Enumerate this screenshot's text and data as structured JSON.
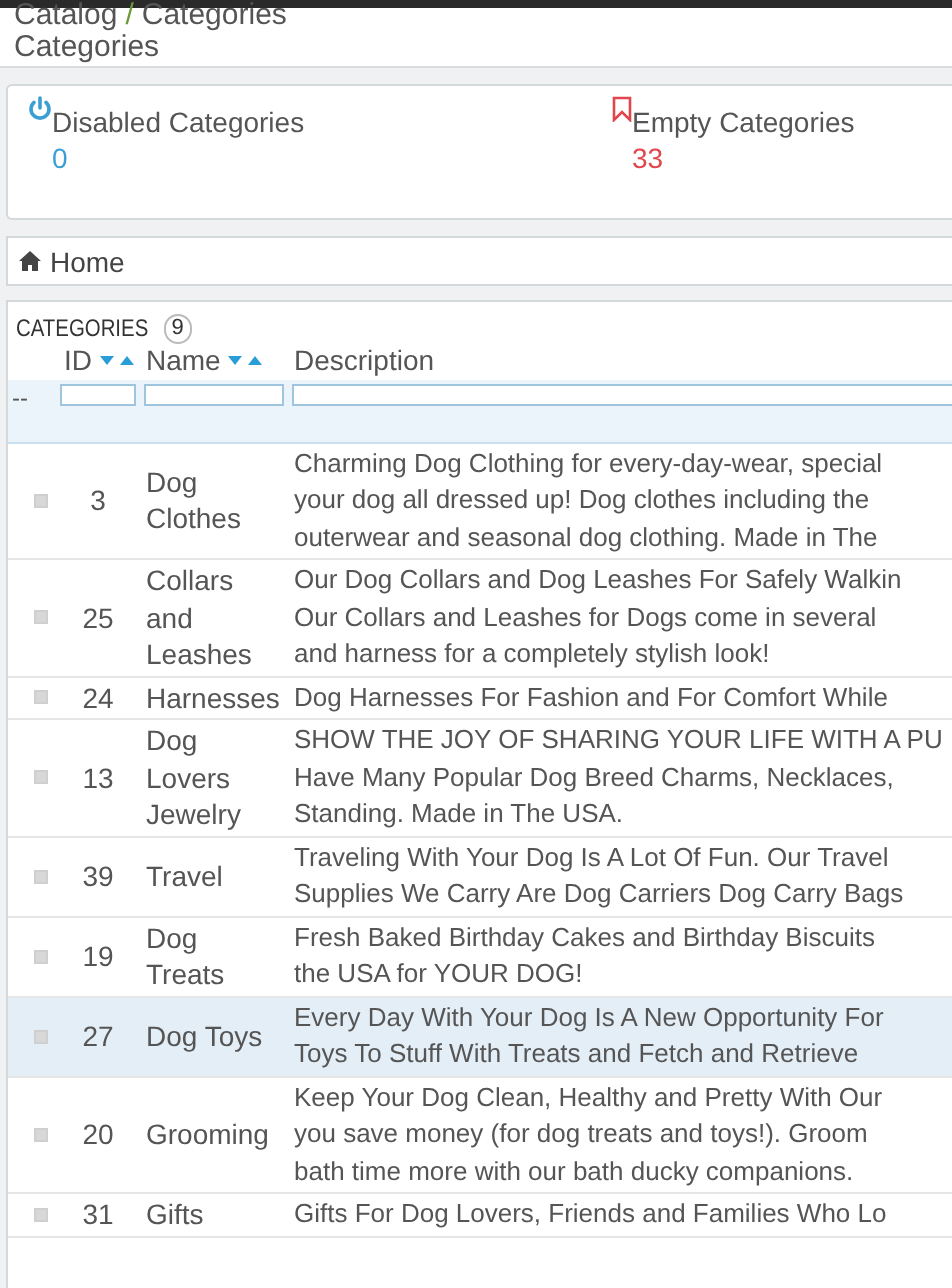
{
  "breadcrumb": {
    "items": [
      "Catalog",
      "Categories"
    ],
    "separator": "/"
  },
  "page_title": "Categories",
  "kpis": [
    {
      "kind": "disabled",
      "label": "Disabled Categories",
      "value": "0",
      "color": "#3c9fd4"
    },
    {
      "kind": "empty",
      "label": "Empty Categories",
      "value": "33",
      "color": "#e0464c"
    }
  ],
  "home_bar": {
    "label": "Home"
  },
  "table": {
    "title": "CATEGORIES",
    "count": "9",
    "columns": [
      {
        "label": "ID",
        "sortable": true
      },
      {
        "label": "Name",
        "sortable": true
      },
      {
        "label": "Description",
        "sortable": false
      }
    ],
    "filter_reset": "--",
    "rows": [
      {
        "id": "3",
        "name": "Dog Clothes",
        "checked": false,
        "highlighted": false,
        "description": [
          "Charming Dog Clothing for every-day-wear, special",
          "your dog all dressed up! Dog clothes including the",
          "outerwear and seasonal dog clothing. Made in The"
        ]
      },
      {
        "id": "25",
        "name": "Collars and Leashes",
        "checked": false,
        "highlighted": false,
        "description": [
          "Our Dog Collars and Dog Leashes For Safely Walkin",
          "Our Collars and Leashes for Dogs come in several",
          "and harness for a completely stylish look!"
        ]
      },
      {
        "id": "24",
        "name": "Harnesses",
        "checked": false,
        "highlighted": false,
        "description": [
          "Dog Harnesses For Fashion and For Comfort While"
        ]
      },
      {
        "id": "13",
        "name": "Dog Lovers Jewelry",
        "checked": false,
        "highlighted": false,
        "description": [
          "SHOW THE JOY OF SHARING YOUR LIFE WITH A PU",
          "Have Many Popular Dog Breed Charms, Necklaces,",
          "Standing. Made in The USA."
        ]
      },
      {
        "id": "39",
        "name": "Travel",
        "checked": false,
        "highlighted": false,
        "description": [
          "Traveling With Your Dog Is A Lot Of Fun. Our Travel",
          "Supplies We Carry Are Dog Carriers Dog Carry Bags"
        ]
      },
      {
        "id": "19",
        "name": "Dog Treats",
        "checked": false,
        "highlighted": false,
        "description": [
          "Fresh Baked Birthday Cakes and Birthday Biscuits",
          "the USA for YOUR DOG!"
        ]
      },
      {
        "id": "27",
        "name": "Dog Toys",
        "checked": false,
        "highlighted": true,
        "description": [
          "Every Day With Your Dog Is A New Opportunity For",
          "Toys To Stuff With Treats and Fetch and Retrieve"
        ]
      },
      {
        "id": "20",
        "name": "Grooming",
        "checked": false,
        "highlighted": false,
        "description": [
          "Keep Your Dog Clean, Healthy and Pretty With Our",
          "you save money (for dog treats and toys!). Groom",
          "bath time more with our bath ducky companions."
        ]
      },
      {
        "id": "31",
        "name": "Gifts",
        "checked": false,
        "highlighted": false,
        "description": [
          "Gifts For Dog Lovers, Friends and Families Who Lo"
        ]
      }
    ]
  }
}
